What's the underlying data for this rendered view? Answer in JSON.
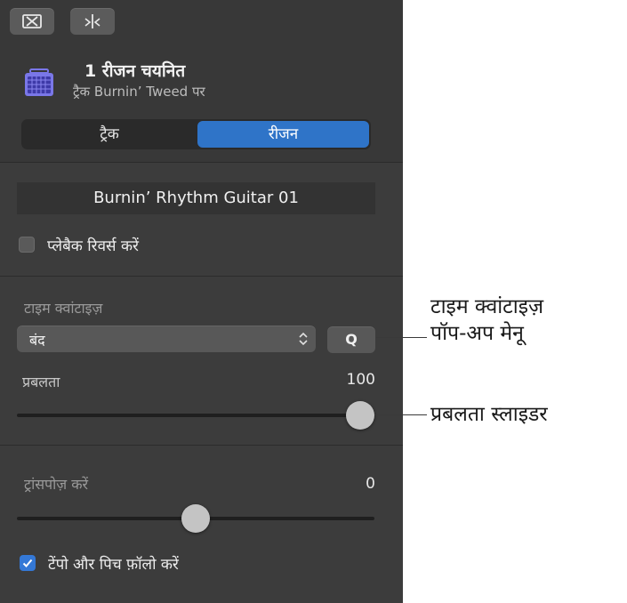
{
  "header": {
    "selection_title": "1 रीजन चयनित",
    "selection_subtitle": "ट्रैक Burnin’ Tweed पर",
    "icons": [
      "region-bounds-icon",
      "split-icon",
      "amp-icon"
    ]
  },
  "segmented": {
    "track_label": "ट्रैक",
    "region_label": "रीजन",
    "selected": "रीजन"
  },
  "region": {
    "name": "Burnin’ Rhythm Guitar 01",
    "reverse_label": "प्लेबैक रिवर्स करें",
    "reverse_checked": false
  },
  "time_quantize": {
    "label": "टाइम क्वांटाइज़",
    "value": "बंद",
    "q_button": "Q"
  },
  "strength": {
    "label": "प्रबलता",
    "value": "100",
    "fraction": 0.96
  },
  "transpose": {
    "label": "ट्रांसपोज़ करें",
    "value": "0",
    "fraction": 0.5
  },
  "tempo": {
    "label": "टेंपो और पिच फ़ॉलो करें",
    "checked": true
  },
  "callouts": {
    "popup_line1": "टाइम क्वांटाइज़",
    "popup_line2": "पॉप-अप मेनू",
    "slider": "प्रबलता स्लाइडर"
  },
  "colors": {
    "accent": "#2f74c8",
    "panel_bg": "#3c3c3c"
  }
}
